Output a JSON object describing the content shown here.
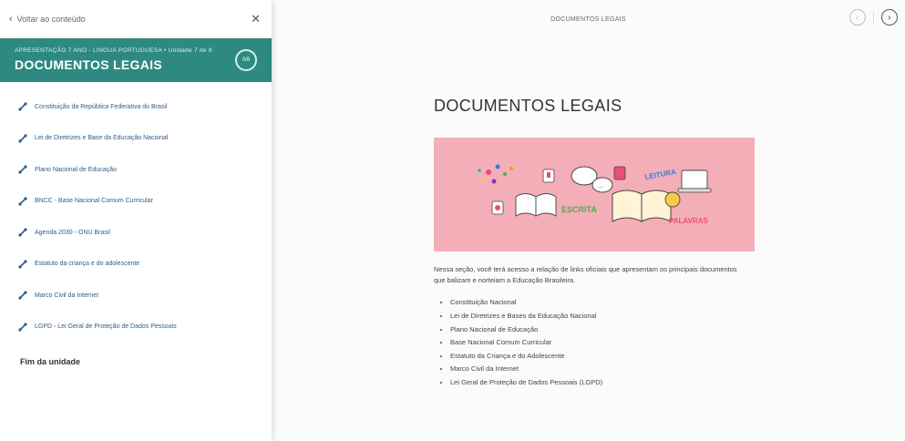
{
  "sidebar": {
    "back_label": "Voltar ao conteúdo",
    "close_icon": "close-icon",
    "breadcrumb": "APRESENTAÇÃO 7 ANO - LINGUA PORTUGUESA • Unidade 7 de 8",
    "unit_title": "DOCUMENTOS LEGAIS",
    "progress": "0/8",
    "items": [
      {
        "label": "Constituição da República Federativa do Brasil"
      },
      {
        "label": "Lei de Diretrizes e Base da Educação Nacional"
      },
      {
        "label": "Plano Nacional de Educação"
      },
      {
        "label": "BNCC - Base Nacional Comum Curricular"
      },
      {
        "label": "Agenda 2030 - ONU Brasil"
      },
      {
        "label": "Estatuto da criança e do adolescente"
      },
      {
        "label": "Marco Civil da Internet"
      },
      {
        "label": "LGPD - Lei Geral de Proteção de Dados Pessoais"
      }
    ],
    "end_label": "Fim da unidade"
  },
  "main": {
    "topbar_title": "DOCUMENTOS LEGAIS",
    "content_title": "DOCUMENTOS LEGAIS",
    "banner_words": [
      "LEITURA",
      "ESCRITA",
      "PALAVRAS"
    ],
    "intro": "Nessa seção, você terá acesso a relação de links oficiais que apresentam os principais documentos que balizam e norteiam a Educação Brasileira.",
    "bullets": [
      "Constituição Nacional",
      "Lei de Diretrizes e Bases da Educação Nacional",
      "Plano Nacional de Educação",
      "Base Nacional Comum Curricular",
      "Estatuto da Criança e do Adolescente",
      "Marco Civil da Internet",
      "Lei Geral de Proteção de Dados Pessoais (LGPD)"
    ]
  },
  "colors": {
    "header_teal": "#2e8a80",
    "link_blue": "#2f5d8a",
    "banner_pink": "#f4aeb8"
  }
}
